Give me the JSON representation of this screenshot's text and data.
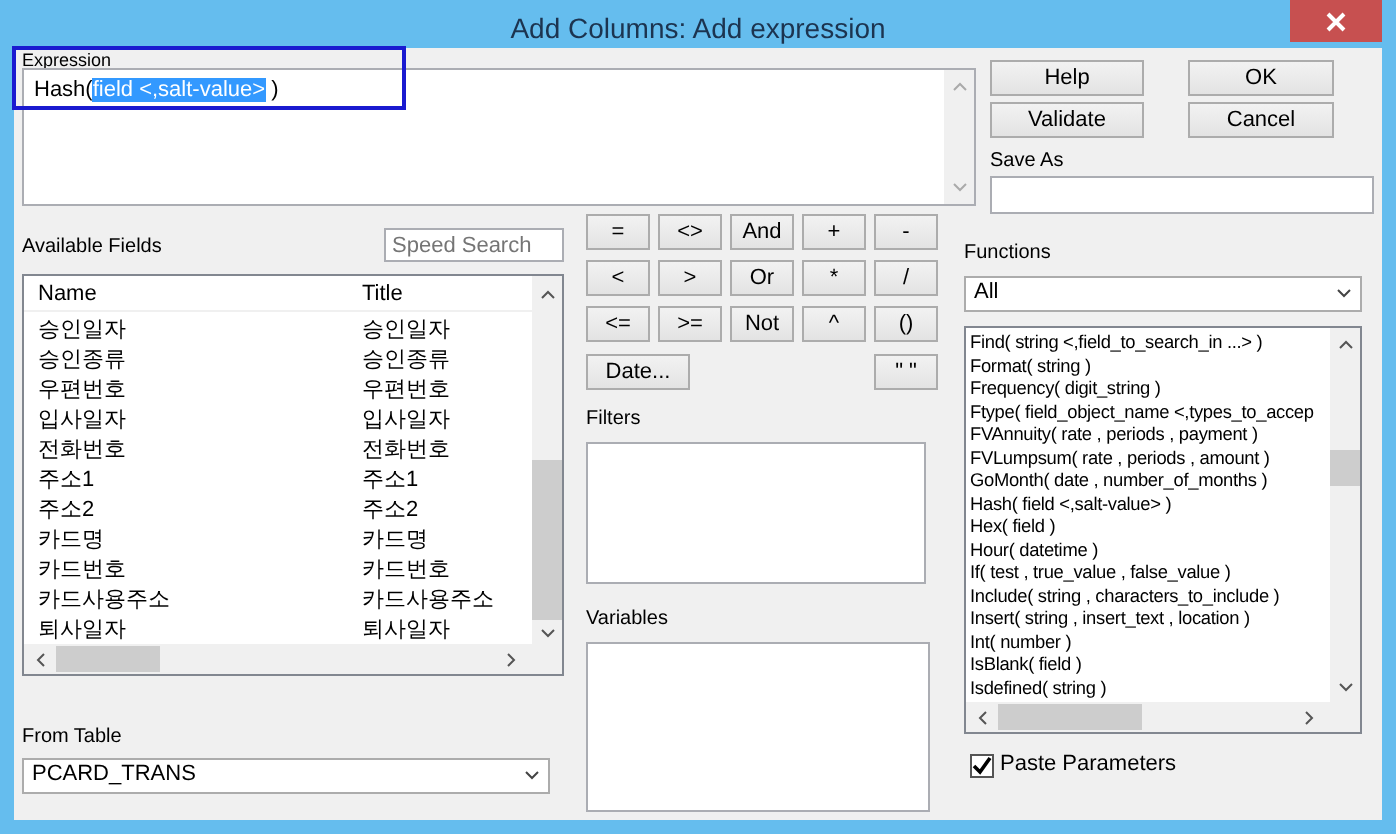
{
  "window": {
    "title": "Add Columns: Add expression"
  },
  "expression": {
    "label": "Expression",
    "text_before": "Hash(",
    "text_selected": "field <,salt-value>",
    "text_after": " )"
  },
  "buttons": [
    "Help",
    "OK",
    "Validate",
    "Cancel"
  ],
  "save_as": {
    "label": "Save As"
  },
  "available_fields": {
    "label": "Available Fields",
    "search": {
      "placeholder": "Speed Search"
    },
    "columns": [
      "Name",
      "Title"
    ],
    "rows": [
      [
        "승인일자",
        "승인일자"
      ],
      [
        "승인종류",
        "승인종류"
      ],
      [
        "우편번호",
        "우편번호"
      ],
      [
        "입사일자",
        "입사일자"
      ],
      [
        "전화번호",
        "전화번호"
      ],
      [
        "주소1",
        "주소1"
      ],
      [
        "주소2",
        "주소2"
      ],
      [
        "카드명",
        "카드명"
      ],
      [
        "카드번호",
        "카드번호"
      ],
      [
        "카드사용주소",
        "카드사용주소"
      ],
      [
        "퇴사일자",
        "퇴사일자"
      ]
    ]
  },
  "from_table": {
    "label": "From Table",
    "value": "PCARD_TRANS"
  },
  "operators": [
    "=",
    "<>",
    "And",
    "+",
    "-",
    "<",
    ">",
    "Or",
    "*",
    "/",
    "<=",
    ">=",
    "Not",
    "^",
    "()"
  ],
  "date_button": "Date...",
  "quote_button": "\" \"",
  "filters": {
    "label": "Filters"
  },
  "variables": {
    "label": "Variables"
  },
  "functions": {
    "label": "Functions",
    "category": "All",
    "items": [
      "Find( string <,field_to_search_in ...> )",
      "Format( string )",
      "Frequency( digit_string )",
      "Ftype( field_object_name <,types_to_accep",
      "FVAnnuity( rate , periods , payment )",
      "FVLumpsum( rate , periods , amount )",
      "GoMonth( date , number_of_months )",
      "Hash( field <,salt-value> )",
      "Hex( field )",
      "Hour( datetime )",
      "If( test , true_value , false_value )",
      "Include( string , characters_to_include )",
      "Insert( string , insert_text , location )",
      "Int( number )",
      "IsBlank( field )",
      "Isdefined( string )"
    ]
  },
  "paste_parameters": {
    "label": "Paste Parameters",
    "checked": true
  }
}
